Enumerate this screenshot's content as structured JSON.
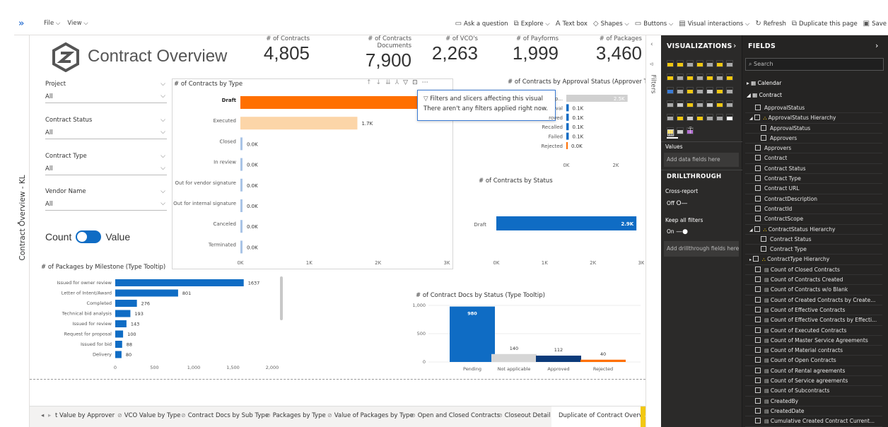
{
  "toolbar": {
    "file": "File",
    "view": "View",
    "items": [
      "Ask a question",
      "Explore",
      "Text box",
      "Shapes",
      "Buttons",
      "Visual interactions",
      "Refresh",
      "Duplicate this page",
      "Save"
    ]
  },
  "page_side_label": "Contract Overview - KL",
  "title": "Contract Overview",
  "kpis": [
    {
      "label": "# of Contracts",
      "value": "4,805"
    },
    {
      "label": "# of Contracts Documents",
      "value": "7,900"
    },
    {
      "label": "# of VCO's",
      "value": "2,263"
    },
    {
      "label": "# of Payforms",
      "value": "1,999"
    },
    {
      "label": "# of Packages",
      "value": "3,460"
    }
  ],
  "slicers": [
    {
      "label": "Project",
      "value": "All"
    },
    {
      "label": "Contract Status",
      "value": "All"
    },
    {
      "label": "Contract Type",
      "value": "All"
    },
    {
      "label": "Vendor Name",
      "value": "All"
    }
  ],
  "toggle": {
    "left": "Count",
    "right": "Value"
  },
  "tooltip": {
    "title": "Filters and slicers affecting this visual",
    "body": "There aren't any filters applied right now."
  },
  "charts_text": {
    "by_type_title": "# of Contracts by Type",
    "approval_title": "# of Contracts by Approval Status (Approver Tooltip)",
    "status_title": "# of Contracts by Status",
    "milestone_title": "# of Packages by Milestone (Type Tooltip)",
    "docs_title": "# of Contract Docs by Status (Type Tooltip)"
  },
  "chart_data": [
    {
      "type": "bar",
      "orientation": "horizontal",
      "title": "# of Contracts by Type",
      "categories": [
        "Draft",
        "Executed",
        "Closed",
        "In review",
        "Out for vendor signature",
        "Out for internal signature",
        "Canceled",
        "Terminated"
      ],
      "values": [
        2900,
        1700,
        0,
        0,
        0,
        0,
        0,
        0
      ],
      "value_labels": [
        "",
        "1.7K",
        "0.0K",
        "0.0K",
        "0.0K",
        "0.0K",
        "0.0K",
        "0.0K"
      ],
      "x_ticks": [
        "0K",
        "1K",
        "2K",
        "3K"
      ],
      "xlim": [
        0,
        3000
      ]
    },
    {
      "type": "bar",
      "orientation": "horizontal",
      "title": "# of Contracts by Approval Status (Approver Tooltip)",
      "categories": [
        "p...",
        "val",
        "roved",
        "Recalled",
        "Failed",
        "Rejected"
      ],
      "values": [
        2500,
        100,
        100,
        100,
        100,
        0
      ],
      "value_labels": [
        "2.5K",
        "0.1K",
        "0.1K",
        "0.1K",
        "0.1K",
        "0.0K"
      ],
      "x_ticks": [
        "0K",
        "2K"
      ],
      "xlim": [
        0,
        3000
      ]
    },
    {
      "type": "bar",
      "orientation": "horizontal",
      "title": "# of Contracts by Status",
      "categories": [
        "Draft"
      ],
      "values": [
        2900
      ],
      "value_labels": [
        "2.9K"
      ],
      "x_ticks": [
        "0K",
        "1K",
        "2K",
        "3K"
      ],
      "xlim": [
        0,
        3000
      ]
    },
    {
      "type": "bar",
      "orientation": "horizontal",
      "title": "# of Packages by Milestone (Type Tooltip)",
      "categories": [
        "Issued for owner review",
        "Letter of Intent/Award",
        "Completed",
        "Technical bid analysis",
        "Issued for review",
        "Request for proposal",
        "Issued for bid",
        "Delivery"
      ],
      "values": [
        1637,
        801,
        276,
        193,
        143,
        100,
        88,
        80
      ],
      "x_ticks": [
        "0",
        "500",
        "1,000",
        "1,500",
        "2,000"
      ],
      "xlim": [
        0,
        2000
      ]
    },
    {
      "type": "bar",
      "orientation": "vertical",
      "title": "# of Contract Docs by Status (Type Tooltip)",
      "categories": [
        "Pending",
        "Not applicable",
        "Approved",
        "Rejected"
      ],
      "values": [
        980,
        140,
        112,
        40
      ],
      "y_ticks": [
        "0",
        "500",
        "1,000"
      ],
      "ylim": [
        0,
        1000
      ]
    }
  ],
  "viz_panel": {
    "header": "VISUALIZATIONS",
    "values_label": "Values",
    "values_placeholder": "Add data fields here",
    "drillthrough": "DRILLTHROUGH",
    "cross_report": "Cross-report",
    "cross_state": "Off",
    "keep_filters": "Keep all filters",
    "keep_state": "On",
    "drill_placeholder": "Add drillthrough fields here"
  },
  "filters_label": "Filters",
  "fields_panel": {
    "header": "FIELDS",
    "search_placeholder": "Search",
    "tables": [
      "Calendar",
      "Contract"
    ],
    "fields": [
      "ApprovalStatus",
      "ApprovalStatus Hierarchy",
      "ApprovalStatus",
      "Approvers",
      "Approvers",
      "Contract",
      "Contract Status",
      "Contract Type",
      "Contract URL",
      "ContractDescription",
      "ContractId",
      "ContractScope",
      "ContractStatus Hierarchy",
      "Contract Status",
      "Contract Type",
      "ContractType Hierarchy",
      "Count of Closed Contracts",
      "Count of Contracts Created",
      "Count of Contracts w/o Blank",
      "Count of Created Contracts by Create...",
      "Count of Effective Contracts",
      "Count of Effective Contracts by Effecti...",
      "Count of Executed Contracts",
      "Count of Master Service Agreements",
      "Count of Material contracts",
      "Count of Open Contracts",
      "Count of Rental agreements",
      "Count of Service agreements",
      "Count of Subcontracts",
      "CreatedBy",
      "CreatedDate",
      "Cumulative Created Contract Current..."
    ]
  },
  "tabs": [
    "t Value by Approver",
    "VCO Value by Type",
    "Contract Docs by Sub Type",
    "Packages by Type",
    "Value of Packages by Type",
    "Open and Closed Contracts",
    "Closeout Detail",
    "Duplicate of Contract Overview"
  ],
  "colors": {
    "orange": "#ff6f00",
    "peach": "#fcd5a8",
    "blue": "#0f6cc4",
    "lightgray": "#d0d0d0",
    "navy": "#0b3a7a",
    "panel": "#252423",
    "accent_tab": "#f2c811"
  }
}
